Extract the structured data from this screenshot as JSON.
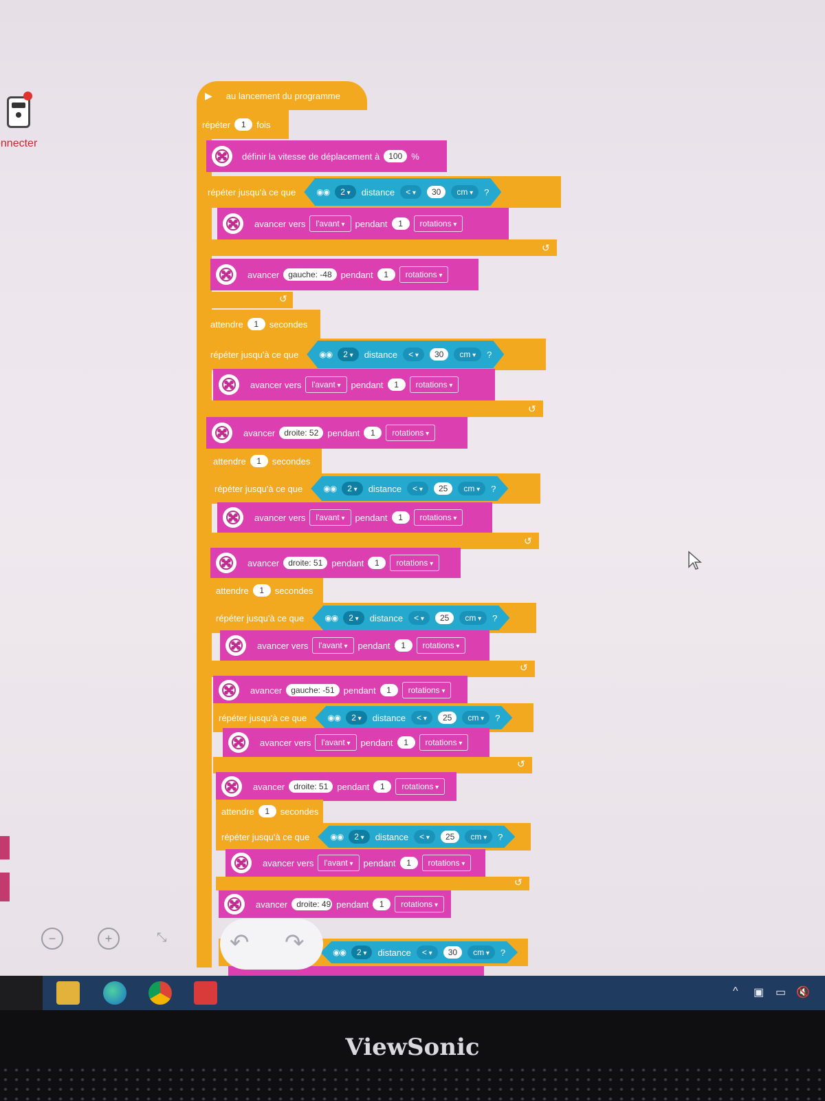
{
  "connect_panel": {
    "label": "onnecter"
  },
  "hat": {
    "label": "au lancement du programme"
  },
  "blocks": {
    "repeat": {
      "prefix": "répéter",
      "count": "1",
      "suffix": "fois"
    },
    "speed": {
      "label": "définir la vitesse de déplacement à",
      "value": "100",
      "unit": "%"
    },
    "loop1": {
      "label": "répéter jusqu'à ce que",
      "port": "2",
      "sensor_label": "distance",
      "op": "<",
      "value": "30",
      "unit": "cm",
      "q": "?",
      "move_label": "avancer vers",
      "direction": "l'avant",
      "for": "pendant",
      "rotations_value": "1",
      "rotations": "rotations"
    },
    "turn1": {
      "label": "avancer",
      "steer": "gauche: -48",
      "for": "pendant",
      "value": "1",
      "unit": "rotations"
    },
    "wait1": {
      "label": "attendre",
      "value": "1",
      "unit": "secondes"
    },
    "loop2": {
      "label": "répéter jusqu'à ce que",
      "port": "2",
      "sensor_label": "distance",
      "op": "<",
      "value": "30",
      "unit": "cm",
      "q": "?",
      "move_label": "avancer vers",
      "direction": "l'avant",
      "for": "pendant",
      "rotations_value": "1",
      "rotations": "rotations"
    },
    "turn2": {
      "label": "avancer",
      "steer": "droite: 52",
      "for": "pendant",
      "value": "1",
      "unit": "rotations"
    },
    "wait2": {
      "label": "attendre",
      "value": "1",
      "unit": "secondes"
    },
    "loop3": {
      "label": "répéter jusqu'à ce que",
      "port": "2",
      "sensor_label": "distance",
      "op": "<",
      "value": "25",
      "unit": "cm",
      "q": "?",
      "move_label": "avancer vers",
      "direction": "l'avant",
      "for": "pendant",
      "rotations_value": "1",
      "rotations": "rotations"
    },
    "turn3": {
      "label": "avancer",
      "steer": "droite: 51",
      "for": "pendant",
      "value": "1",
      "unit": "rotations"
    },
    "wait3": {
      "label": "attendre",
      "value": "1",
      "unit": "secondes"
    },
    "loop4": {
      "label": "répéter jusqu'à ce que",
      "port": "2",
      "sensor_label": "distance",
      "op": "<",
      "value": "25",
      "unit": "cm",
      "q": "?",
      "move_label": "avancer vers",
      "direction": "l'avant",
      "for": "pendant",
      "rotations_value": "1",
      "rotations": "rotations"
    },
    "turn4": {
      "label": "avancer",
      "steer": "gauche: -51",
      "for": "pendant",
      "value": "1",
      "unit": "rotations"
    },
    "loop5": {
      "label": "répéter jusqu'à ce que",
      "port": "2",
      "sensor_label": "distance",
      "op": "<",
      "value": "25",
      "unit": "cm",
      "q": "?",
      "move_label": "avancer vers",
      "direction": "l'avant",
      "for": "pendant",
      "rotations_value": "1",
      "rotations": "rotations"
    },
    "turn5": {
      "label": "avancer",
      "steer": "droite: 51",
      "for": "pendant",
      "value": "1",
      "unit": "rotations"
    },
    "wait4": {
      "label": "attendre",
      "value": "1",
      "unit": "secondes"
    },
    "loop6": {
      "label": "répéter jusqu'à ce que",
      "port": "2",
      "sensor_label": "distance",
      "op": "<",
      "value": "25",
      "unit": "cm",
      "q": "?",
      "move_label": "avancer vers",
      "direction": "l'avant",
      "for": "pendant",
      "rotations_value": "1",
      "rotations": "rotations"
    },
    "turn6": {
      "label": "avancer",
      "steer": "droite: 49",
      "for": "pendant",
      "value": "1",
      "unit": "rotations"
    },
    "loop7": {
      "port": "2",
      "sensor_label": "distance",
      "op": "<",
      "value": "30",
      "unit": "cm",
      "q": "?"
    }
  },
  "toolbar": {
    "zoom_out": "−",
    "zoom_in": "+",
    "fit": "⤡",
    "undo": "↶",
    "redo": "↷"
  },
  "monitor": {
    "brand": "ViewSonic"
  },
  "colors": {
    "control": "#f2a91f",
    "motor": "#dc3fb0",
    "sensor": "#25a9cf",
    "taskbar": "#1f3b5f"
  }
}
